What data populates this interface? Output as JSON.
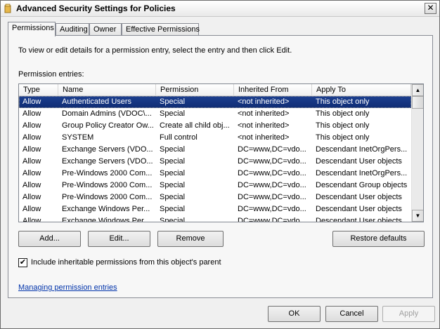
{
  "window": {
    "title": "Advanced Security Settings for Policies",
    "close_glyph": "✕"
  },
  "tabs": [
    {
      "label": "Permissions",
      "active": true
    },
    {
      "label": "Auditing",
      "active": false
    },
    {
      "label": "Owner",
      "active": false
    },
    {
      "label": "Effective Permissions",
      "active": false
    }
  ],
  "intro_text": "To view or edit details for a permission entry, select the entry and then click Edit.",
  "entries_label": "Permission entries:",
  "columns": [
    "Type",
    "Name",
    "Permission",
    "Inherited From",
    "Apply To"
  ],
  "rows": [
    [
      "Allow",
      "Authenticated Users",
      "Special",
      "<not inherited>",
      "This object only"
    ],
    [
      "Allow",
      "Domain Admins (VDOC\\...",
      "Special",
      "<not inherited>",
      "This object only"
    ],
    [
      "Allow",
      "Group Policy Creator Ow...",
      "Create all child obj...",
      "<not inherited>",
      "This object only"
    ],
    [
      "Allow",
      "SYSTEM",
      "Full control",
      "<not inherited>",
      "This object only"
    ],
    [
      "Allow",
      "Exchange Servers (VDO...",
      "Special",
      "DC=www,DC=vdo...",
      "Descendant InetOrgPers..."
    ],
    [
      "Allow",
      "Exchange Servers (VDO...",
      "Special",
      "DC=www,DC=vdo...",
      "Descendant User objects"
    ],
    [
      "Allow",
      "Pre-Windows 2000 Com...",
      "Special",
      "DC=www,DC=vdo...",
      "Descendant InetOrgPers..."
    ],
    [
      "Allow",
      "Pre-Windows 2000 Com...",
      "Special",
      "DC=www,DC=vdo...",
      "Descendant Group objects"
    ],
    [
      "Allow",
      "Pre-Windows 2000 Com...",
      "Special",
      "DC=www,DC=vdo...",
      "Descendant User objects"
    ],
    [
      "Allow",
      "Exchange Windows Per...",
      "Special",
      "DC=www,DC=vdo...",
      "Descendant User objects"
    ],
    [
      "Allow",
      "Exchange Windows Per...",
      "Special",
      "DC=www,DC=vdo...",
      "Descendant User objects"
    ]
  ],
  "selected_row": 0,
  "buttons": {
    "add": "Add...",
    "edit": "Edit...",
    "remove": "Remove",
    "restore": "Restore defaults",
    "ok": "OK",
    "cancel": "Cancel",
    "apply": "Apply"
  },
  "inherit_checkbox": {
    "label": "Include inheritable permissions from this object's parent",
    "checked": true,
    "glyph": "✔"
  },
  "help_link": "Managing permission entries",
  "scroll_glyphs": {
    "up": "▲",
    "down": "▼"
  }
}
